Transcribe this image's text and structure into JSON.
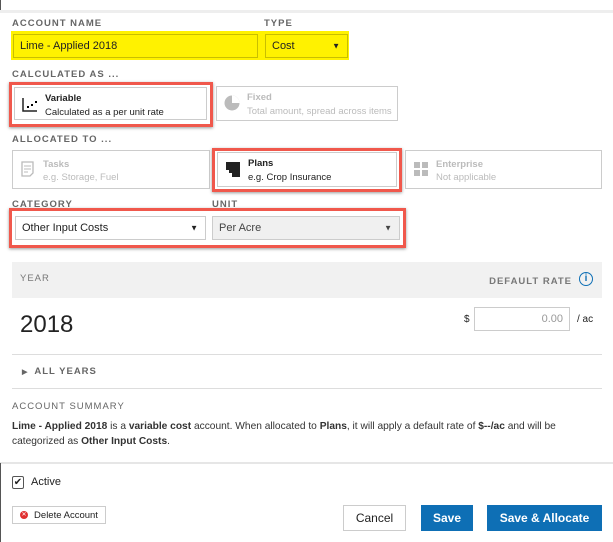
{
  "account_name": {
    "label": "ACCOUNT NAME",
    "value": "Lime - Applied 2018"
  },
  "type": {
    "label": "TYPE",
    "value": "Cost"
  },
  "calculated_as": {
    "label": "CALCULATED AS ...",
    "options": [
      {
        "title": "Variable",
        "subtitle": "Calculated as a per unit rate",
        "selected": true
      },
      {
        "title": "Fixed",
        "subtitle": "Total amount, spread across items",
        "selected": false
      }
    ]
  },
  "allocated_to": {
    "label": "ALLOCATED TO ...",
    "options": [
      {
        "title": "Tasks",
        "subtitle": "e.g. Storage, Fuel",
        "selected": false
      },
      {
        "title": "Plans",
        "subtitle": "e.g. Crop Insurance",
        "selected": true
      },
      {
        "title": "Enterprise",
        "subtitle": "Not applicable",
        "selected": false
      }
    ]
  },
  "category": {
    "label": "CATEGORY",
    "value": "Other Input Costs"
  },
  "unit": {
    "label": "UNIT",
    "value": "Per Acre"
  },
  "rates": {
    "year_header": "YEAR",
    "rate_header": "DEFAULT RATE",
    "year": "2018",
    "currency": "$",
    "rate_placeholder": "0.00",
    "per_unit": "/ ac"
  },
  "all_years": "ALL YEARS",
  "summary": {
    "label": "ACCOUNT SUMMARY",
    "name": "Lime - Applied 2018",
    "t1": " is a ",
    "kind": "variable cost",
    "t2": " account. When allocated to ",
    "alloc": "Plans",
    "t3": ", it will apply a default rate of ",
    "rate": "$--/ac",
    "t4": " and will be categorized as ",
    "cat": "Other Input Costs",
    "t5": "."
  },
  "active": {
    "label": "Active",
    "checked": true
  },
  "buttons": {
    "delete": "Delete Account",
    "cancel": "Cancel",
    "save": "Save",
    "save_allocate": "Save & Allocate"
  },
  "colors": {
    "highlight": "#fff200",
    "annotation": "#f0584c",
    "primary": "#0e6fb5"
  }
}
